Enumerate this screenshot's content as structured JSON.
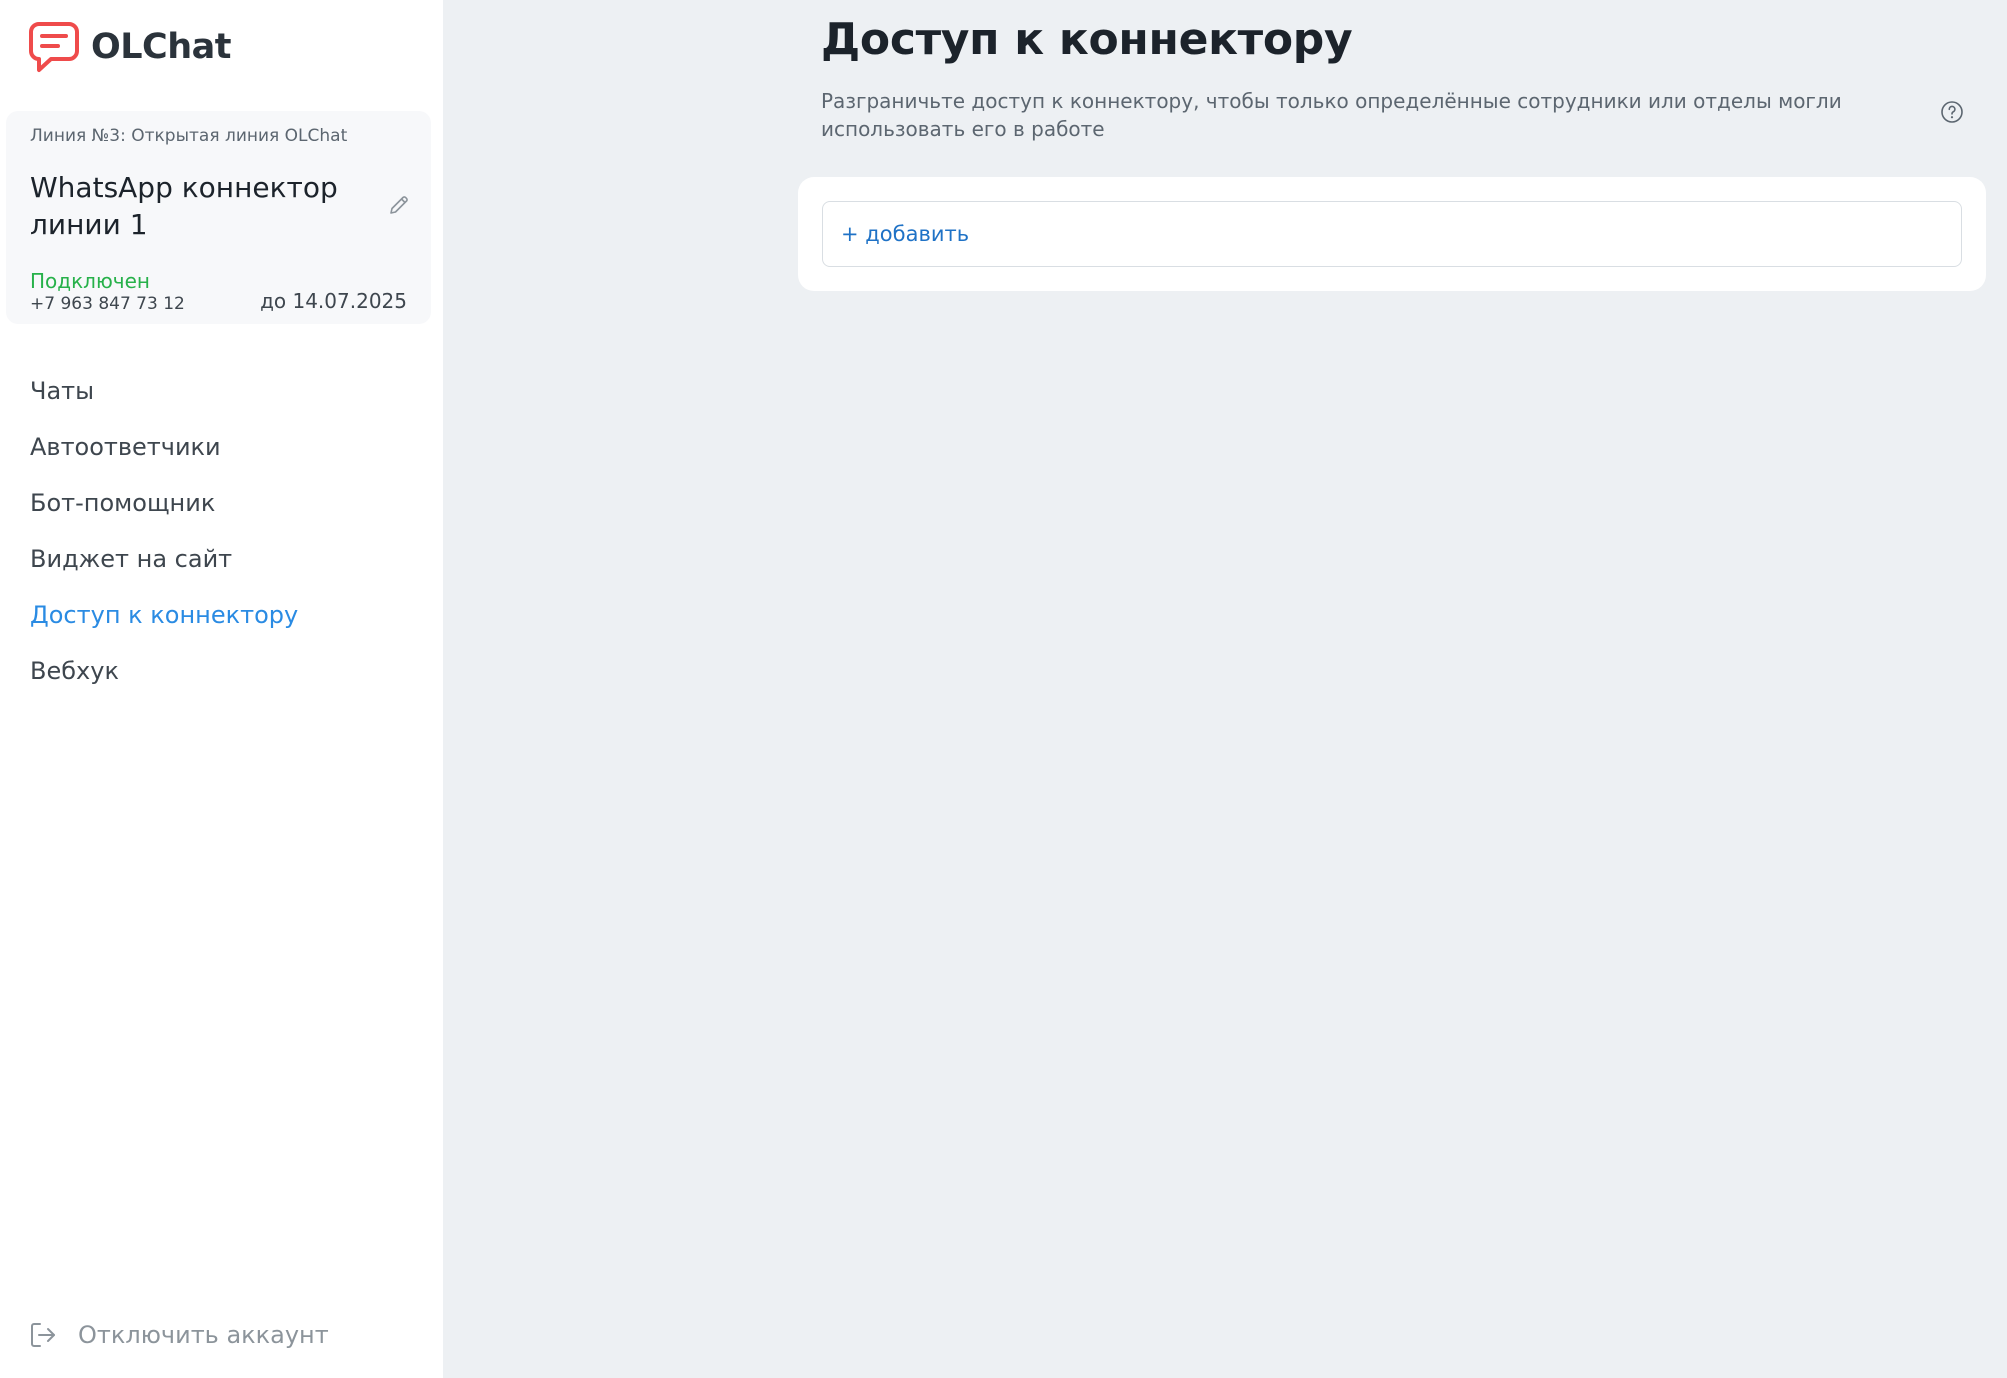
{
  "app": {
    "name": "OLChat"
  },
  "line_card": {
    "caption": "Линия №3: Открытая линия OLChat",
    "connector_name": "WhatsApp коннектор линии 1",
    "status": "Подключен",
    "phone": "+7 963 847 73 12",
    "expiry": "до 14.07.2025"
  },
  "nav": {
    "items": [
      {
        "label": "Чаты",
        "active": false
      },
      {
        "label": "Автоответчики",
        "active": false
      },
      {
        "label": "Бот-помощник",
        "active": false
      },
      {
        "label": "Виджет на сайт",
        "active": false
      },
      {
        "label": "Доступ к коннектору",
        "active": true
      },
      {
        "label": "Вебхук",
        "active": false
      }
    ]
  },
  "logout": {
    "label": "Отключить аккаунт"
  },
  "main": {
    "title": "Доступ к коннектору",
    "description": "Разграничьте доступ к коннектору, чтобы только определённые сотрудники или отделы могли использовать его в работе",
    "add_label": "+ добавить"
  },
  "colors": {
    "accent": "#2a8be3",
    "link": "#1f72c6",
    "status_connected": "#27b14a",
    "brand_logo": "#ef4b4b",
    "page_bg": "#edf0f3"
  },
  "icons": {
    "logo": "chat-bubble-logo-icon",
    "edit": "pencil-icon",
    "help": "question-circle-icon",
    "logout": "logout-icon"
  }
}
